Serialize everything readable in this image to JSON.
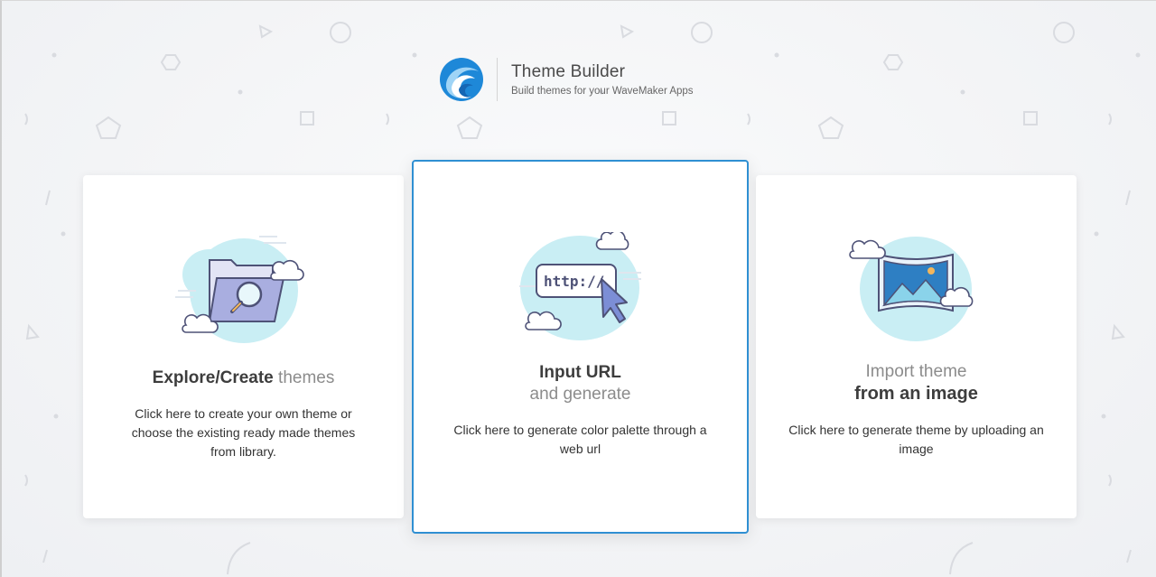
{
  "header": {
    "title": "Theme Builder",
    "subtitle": "Build themes for your WaveMaker Apps"
  },
  "colors": {
    "accent": "#2f8fd2",
    "cloud": "#c9eef4",
    "outline": "#4e5277"
  },
  "cards": [
    {
      "heading_strong": "Explore/Create",
      "heading_light": "themes",
      "description": "Click here to create your own theme or choose the existing ready made themes from library.",
      "illustration": "folder-search-icon"
    },
    {
      "heading_strong": "Input URL",
      "heading_light": "and generate",
      "description": "Click here to generate color palette through a web url",
      "illustration_text": "http://",
      "illustration": "url-cursor-icon"
    },
    {
      "heading_light": "Import theme",
      "heading_strong": "from an image",
      "description": "Click here to generate theme by uploading an image",
      "illustration": "image-landscape-icon"
    }
  ]
}
